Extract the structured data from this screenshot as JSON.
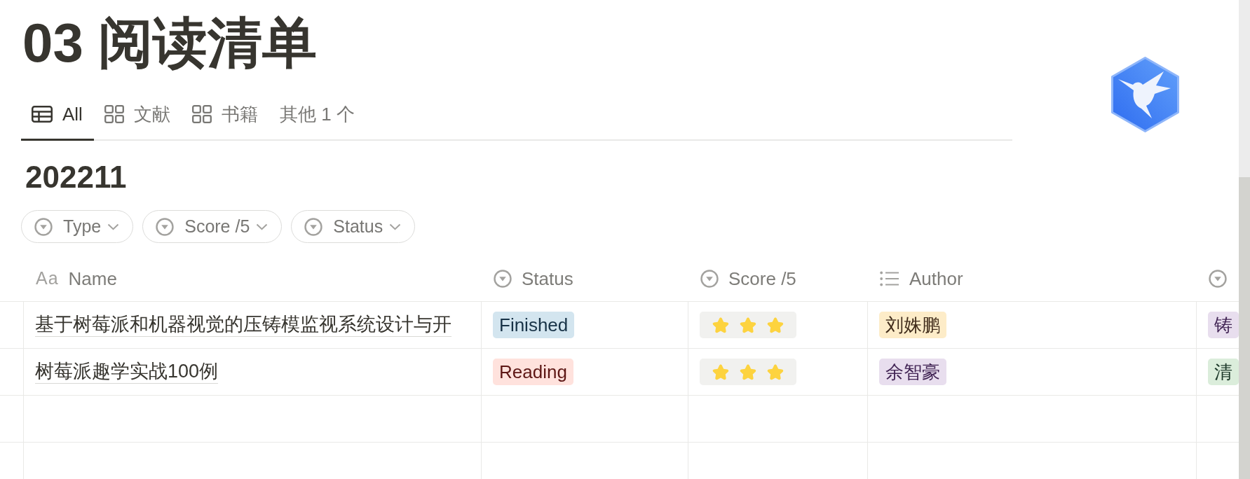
{
  "page": {
    "title": "03 阅读清单"
  },
  "view_tabs": [
    {
      "label": "All",
      "kind": "table",
      "selected": true
    },
    {
      "label": "文献",
      "kind": "gallery",
      "selected": false
    },
    {
      "label": "书籍",
      "kind": "gallery",
      "selected": false
    },
    {
      "label": "其他 1 个",
      "kind": "more",
      "selected": false
    }
  ],
  "group": {
    "heading": "202211",
    "filters": [
      {
        "label": "Type"
      },
      {
        "label": "Score /5"
      },
      {
        "label": "Status"
      }
    ]
  },
  "table": {
    "columns": [
      {
        "kind": "title",
        "type_mark": "Aa",
        "label": "Name"
      },
      {
        "kind": "select",
        "label": "Status"
      },
      {
        "kind": "select",
        "label": "Score /5"
      },
      {
        "kind": "multi_select",
        "label": "Author"
      },
      {
        "kind": "select"
      }
    ],
    "rows": [
      {
        "cells": [
          {
            "kind": "title",
            "text": "基于树莓派和机器视觉的压铸模监视系统设计与开"
          },
          {
            "kind": "tag",
            "text": "Finished",
            "color": "#d3e5ef"
          },
          {
            "kind": "stars",
            "stars": 3
          },
          {
            "kind": "tag",
            "text": "刘姝鹏",
            "color": "#fdecc8"
          },
          {
            "kind": "tag",
            "text": "铸",
            "color": "#e8deee"
          }
        ]
      },
      {
        "cells": [
          {
            "kind": "title",
            "text": "树莓派趣学实战100例"
          },
          {
            "kind": "tag",
            "text": "Reading",
            "color": "#ffe2dd"
          },
          {
            "kind": "stars",
            "stars": 3
          },
          {
            "kind": "tag",
            "text": "余智豪",
            "color": "#e8deee"
          },
          {
            "kind": "tag",
            "text": "清",
            "color": "#dbeddb"
          }
        ]
      }
    ]
  }
}
